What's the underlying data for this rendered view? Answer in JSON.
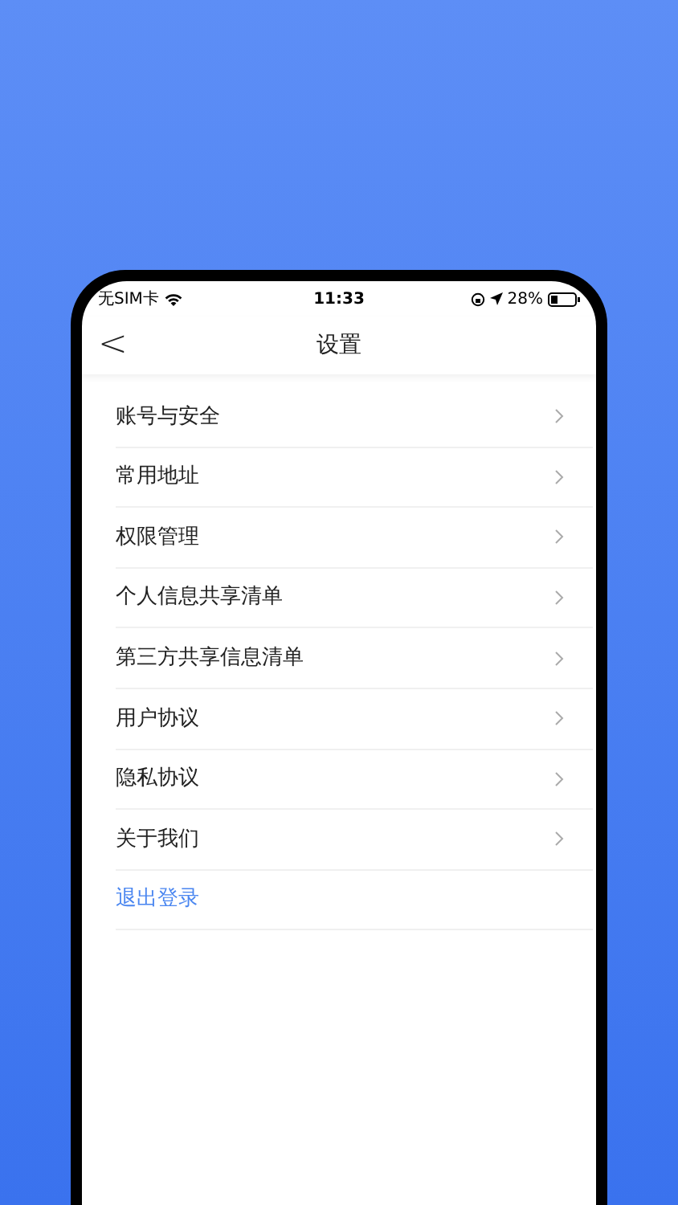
{
  "status_bar": {
    "carrier": "无SIM卡",
    "time": "11:33",
    "battery": "28%"
  },
  "nav": {
    "back": "<",
    "title": "设置"
  },
  "items": [
    {
      "label": "账号与安全",
      "kind": "nav"
    },
    {
      "label": "常用地址",
      "kind": "nav"
    },
    {
      "label": "权限管理",
      "kind": "nav"
    },
    {
      "label": "个人信息共享清单",
      "kind": "nav"
    },
    {
      "label": "第三方共享信息清单",
      "kind": "nav"
    },
    {
      "label": "用户协议",
      "kind": "nav"
    },
    {
      "label": "隐私协议",
      "kind": "nav"
    },
    {
      "label": "关于我们",
      "kind": "nav"
    },
    {
      "label": "退出登录",
      "kind": "action"
    }
  ]
}
